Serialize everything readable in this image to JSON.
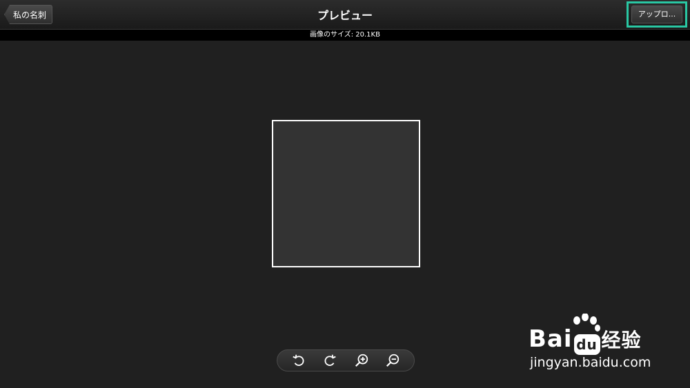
{
  "header": {
    "back_label": "私の名刺",
    "title": "プレビュー",
    "upload_label": "アップロ..."
  },
  "info": {
    "image_size_text": "画像のサイズ: 20.1KB"
  },
  "toolbar": {
    "tools": [
      "rotate-left",
      "rotate-right",
      "zoom-in",
      "zoom-out"
    ]
  },
  "watermark": {
    "brand": "Bai",
    "brand_tail": "经验",
    "url": "jingyan.baidu.com"
  },
  "colors": {
    "highlight": "#29c7a3",
    "background": "#202020"
  }
}
